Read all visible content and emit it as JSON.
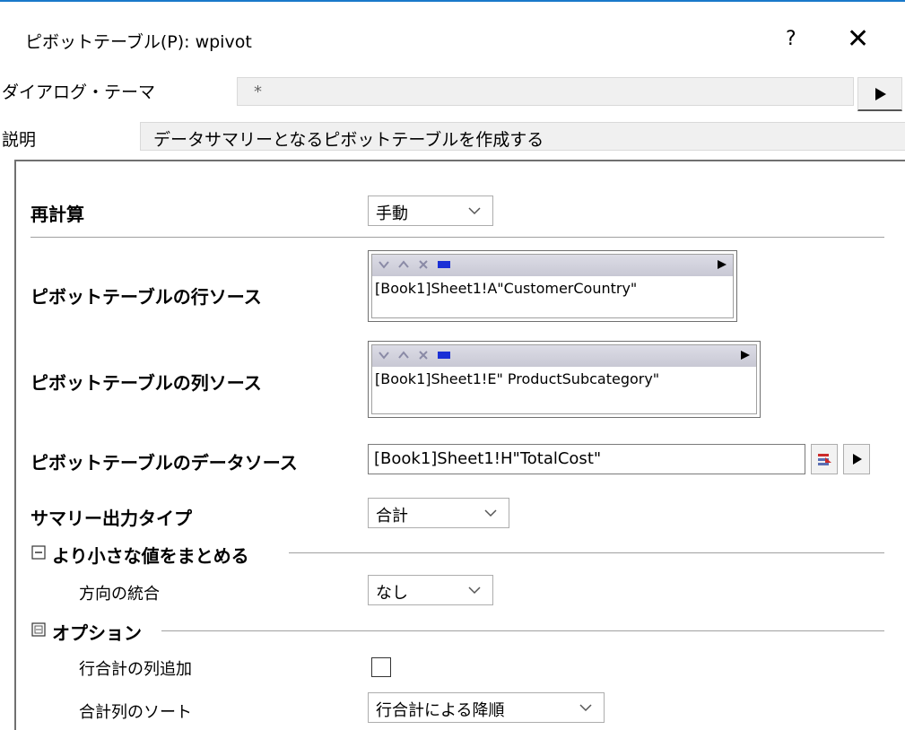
{
  "window": {
    "title": "ピボットテーブル(P): wpivot",
    "help_label": "?",
    "close_label": "✕"
  },
  "theme": {
    "label": "ダイアログ・テーマ",
    "value": "*"
  },
  "description": {
    "label": "説明",
    "value": "データサマリーとなるピボットテーブルを作成する"
  },
  "form": {
    "recalc": {
      "label": "再計算",
      "value": "手動"
    },
    "row_source": {
      "label": "ピボットテーブルの行ソース",
      "value": "[Book1]Sheet1!A\"CustomerCountry\""
    },
    "col_source": {
      "label": "ピボットテーブルの列ソース",
      "value": "[Book1]Sheet1!E\" ProductSubcategory\""
    },
    "data_source": {
      "label": "ピボットテーブルのデータソース",
      "value": "[Book1]Sheet1!H\"TotalCost\""
    },
    "summary_type": {
      "label": "サマリー出力タイプ",
      "value": "合計"
    },
    "merge_section": {
      "label": "より小さな値をまとめる",
      "direction_label": "方向の統合",
      "direction_value": "なし"
    },
    "options_section": {
      "label": "オプション",
      "add_total_label": "行合計の列追加",
      "add_total_checked": false,
      "sort_label": "合計列のソート",
      "sort_value": "行合計による降順"
    }
  },
  "icons": {
    "toolbar": [
      "chevron-down-icon",
      "chevron-up-icon",
      "delete-x-icon",
      "select-range-icon",
      "play-arrow-icon"
    ],
    "data_source_picker": "select-range-red-icon"
  },
  "colors": {
    "titlebar_accent": "#1979ca",
    "toolbar_blue": "#1a2fd6",
    "picker_red": "#cc2a2a"
  }
}
